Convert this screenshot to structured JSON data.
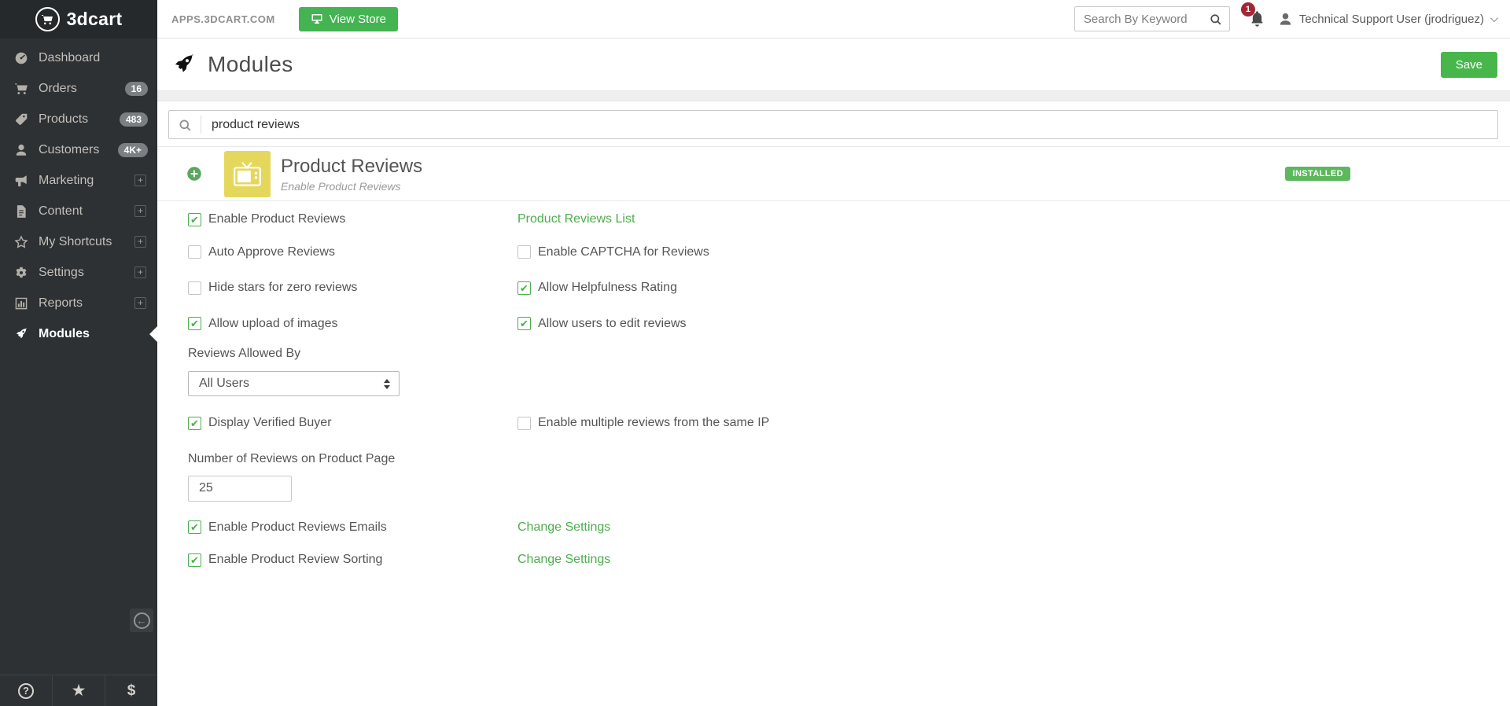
{
  "topbar": {
    "domain_label": "APPS.3DCART.COM",
    "view_store_label": "View Store",
    "search_placeholder": "Search By Keyword",
    "notification_count": "1",
    "user_name": "Technical Support User (jrodriguez)"
  },
  "sidebar": {
    "logo_text": "3dcart",
    "items": [
      {
        "label": "Dashboard"
      },
      {
        "label": "Orders",
        "badge": "16"
      },
      {
        "label": "Products",
        "badge": "483"
      },
      {
        "label": "Customers",
        "badge": "4K+"
      },
      {
        "label": "Marketing"
      },
      {
        "label": "Content"
      },
      {
        "label": "My Shortcuts"
      },
      {
        "label": "Settings"
      },
      {
        "label": "Reports"
      },
      {
        "label": "Modules"
      }
    ],
    "footer_icons": [
      {
        "name": "help-icon",
        "glyph": "?"
      },
      {
        "name": "favorites-icon",
        "glyph": "★"
      },
      {
        "name": "billing-icon",
        "glyph": "$"
      }
    ]
  },
  "page": {
    "title": "Modules",
    "save_label": "Save"
  },
  "module_search": {
    "value": "product reviews"
  },
  "module_card": {
    "title": "Product Reviews",
    "subtitle": "Enable Product Reviews",
    "status": "INSTALLED"
  },
  "settings": {
    "enable_product_reviews": {
      "label": "Enable Product Reviews",
      "checked": true
    },
    "product_reviews_list_link": "Product Reviews List",
    "auto_approve": {
      "label": "Auto Approve Reviews",
      "checked": false
    },
    "captcha": {
      "label": "Enable CAPTCHA for Reviews",
      "checked": false
    },
    "hide_stars": {
      "label": "Hide stars for zero reviews",
      "checked": false
    },
    "helpfulness": {
      "label": "Allow Helpfulness Rating",
      "checked": true
    },
    "allow_upload": {
      "label": "Allow upload of images",
      "checked": true
    },
    "edit_reviews": {
      "label": "Allow users to edit reviews",
      "checked": true
    },
    "reviews_allowed_by": {
      "label": "Reviews Allowed By",
      "value": "All Users"
    },
    "display_verified": {
      "label": "Display Verified Buyer",
      "checked": true
    },
    "multiple_ip": {
      "label": "Enable multiple reviews from the same IP",
      "checked": false
    },
    "num_reviews": {
      "label": "Number of Reviews on Product Page",
      "value": "25"
    },
    "emails": {
      "label": "Enable Product Reviews Emails",
      "checked": true,
      "link": "Change Settings"
    },
    "sorting": {
      "label": "Enable Product Review Sorting",
      "checked": true,
      "link": "Change Settings"
    }
  },
  "colors": {
    "accent_green": "#47b74b",
    "link_green": "#4cae4c",
    "badge_red": "#a32638",
    "module_tile_yellow": "#e5d75c",
    "sidebar_bg": "#2d3134"
  }
}
